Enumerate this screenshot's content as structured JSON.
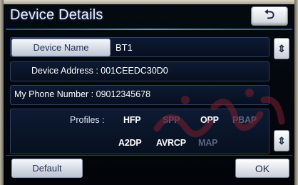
{
  "title": "Device Details",
  "back_icon": "return-arrow-icon",
  "device_name": {
    "button_label": "Device Name",
    "value": "BT1"
  },
  "device_address": {
    "text": "Device Address : 001CEEDC30D0"
  },
  "my_phone_number": {
    "text": "My Phone Number : 09012345678"
  },
  "profiles": {
    "label": "Profiles :",
    "items": [
      {
        "label": "HFP",
        "enabled": true
      },
      {
        "label": "SPP",
        "enabled": false
      },
      {
        "label": "OPP",
        "enabled": true
      },
      {
        "label": "PBAP",
        "enabled": false
      },
      {
        "label": "A2DP",
        "enabled": true
      },
      {
        "label": "AVRCP",
        "enabled": true
      },
      {
        "label": "MAP",
        "enabled": false
      }
    ]
  },
  "side_buttons": {
    "top_icon": "scroll-icon",
    "bottom_icon": "scroll-icon"
  },
  "footer": {
    "default_label": "Default",
    "ok_label": "OK"
  },
  "colors": {
    "accent": "#6b93d8",
    "background": "#050a12",
    "button": "#e4e8ef",
    "disabled_text": "#566683"
  }
}
